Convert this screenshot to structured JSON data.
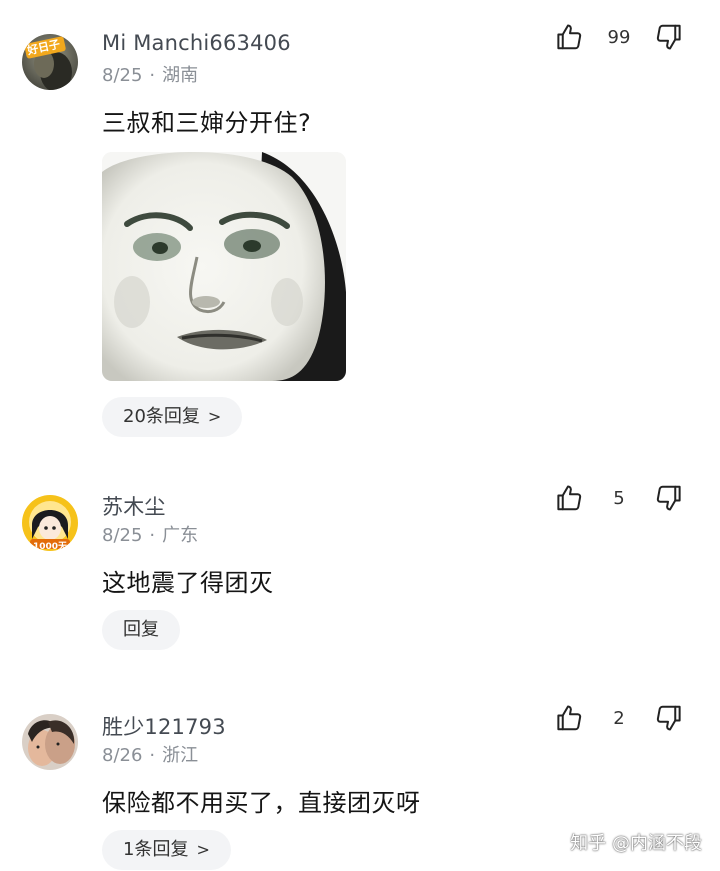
{
  "comments": [
    {
      "username": "Mi Manchi663406",
      "date": "8/25",
      "location": "湖南",
      "text": "三叔和三婶分开住?",
      "likes": "99",
      "has_image": true,
      "avatar_badge": "好日子",
      "reply_label": "20条回复"
    },
    {
      "username": "苏木尘",
      "date": "8/25",
      "location": "广东",
      "text": "这地震了得团灭",
      "likes": "5",
      "avatar_badge": "1000天",
      "reply_label": "回复"
    },
    {
      "username": "胜少121793",
      "date": "8/26",
      "location": "浙江",
      "text": "保险都不用买了，直接团灭呀",
      "likes": "2",
      "reply_label": "1条回复"
    }
  ],
  "separator": "·",
  "chevron": ">",
  "watermark": "知乎 @内涵不段",
  "icons": {
    "like": "thumbs-up-icon",
    "dislike": "thumbs-down-icon",
    "reply_chevron": "chevron-right-icon"
  },
  "colors": {
    "username": "#444a52",
    "meta": "#8a8f96",
    "pill_bg": "#f3f4f6",
    "text": "#151515"
  }
}
